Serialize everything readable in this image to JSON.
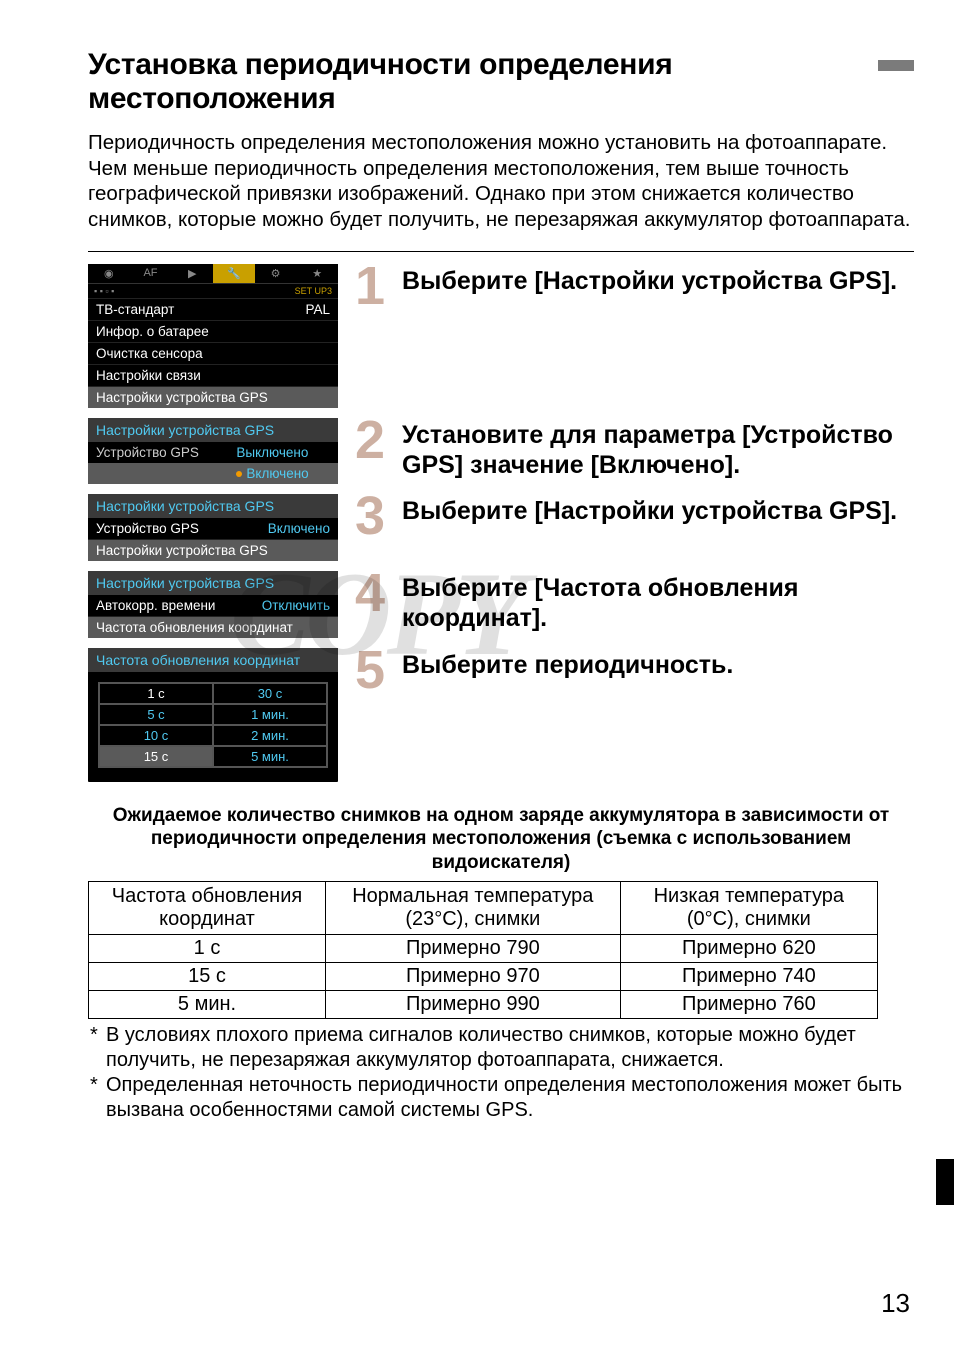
{
  "title": "Установка периодичности определения местоположения",
  "intro": "Периодичность определения местоположения можно установить на фотоаппарате. Чем меньше периодичность определения местоположения, тем выше точность географической привязки изображений. Однако при этом снижается количество снимков, которые можно будет получить, не перезаряжая аккумулятор фотоаппарата.",
  "watermark": "COPY",
  "menu1": {
    "set_label": "SET UP3",
    "rows": [
      {
        "label": "ТВ-стандарт",
        "value": "PAL"
      },
      {
        "label": "Инфор. о батарее",
        "value": ""
      },
      {
        "label": "Очистка сенсора",
        "value": ""
      },
      {
        "label": "Настройки связи",
        "value": ""
      },
      {
        "label": "Настройки устройства GPS",
        "value": ""
      }
    ]
  },
  "menu2": {
    "title": "Настройки устройства GPS",
    "param": "Устройство GPS",
    "opt_off": "Выключено",
    "opt_on": "Включено"
  },
  "menu3": {
    "title": "Настройки устройства GPS",
    "row1_label": "Устройство GPS",
    "row1_value": "Включено",
    "row2_label": "Настройки устройства GPS"
  },
  "menu4": {
    "title": "Настройки устройства GPS",
    "row1_label": "Автокорр. времени",
    "row1_value": "Отключить",
    "row2_label": "Частота обновления координат"
  },
  "menu5": {
    "title": "Частота обновления координат",
    "options": [
      [
        "1 с",
        "30 с"
      ],
      [
        "5 с",
        "1 мин."
      ],
      [
        "10 с",
        "2 мин."
      ],
      [
        "15 с",
        "5 мин."
      ]
    ]
  },
  "steps": [
    {
      "num": "1",
      "text": "Выберите [Настройки устройства GPS]."
    },
    {
      "num": "2",
      "text": "Установите для параметра [Устройство GPS] значение [Включено]."
    },
    {
      "num": "3",
      "text": "Выберите [Настройки устройства GPS]."
    },
    {
      "num": "4",
      "text": "Выберите [Частота обновления координат]."
    },
    {
      "num": "5",
      "text": "Выберите периодичность."
    }
  ],
  "table_caption": "Ожидаемое количество снимков на одном заряде аккумулятора в зависимости от периодичности определения местоположения (съемка с использованием видоискателя)",
  "table_headers": [
    "Частота обновления координат",
    "Нормальная температура (23°C), снимки",
    "Низкая температура (0°C), снимки"
  ],
  "table_rows": [
    [
      "1 с",
      "Примерно 790",
      "Примерно 620"
    ],
    [
      "15 с",
      "Примерно 970",
      "Примерно 740"
    ],
    [
      "5 мин.",
      "Примерно 990",
      "Примерно 760"
    ]
  ],
  "footnotes": [
    "В условиях плохого приема сигналов количество снимков, которые можно будет получить, не перезаряжая аккумулятор фотоаппарата, снижается.",
    "Определенная неточность периодичности определения местоположения может быть вызвана особенностями самой системы GPS."
  ],
  "page_number": "13"
}
